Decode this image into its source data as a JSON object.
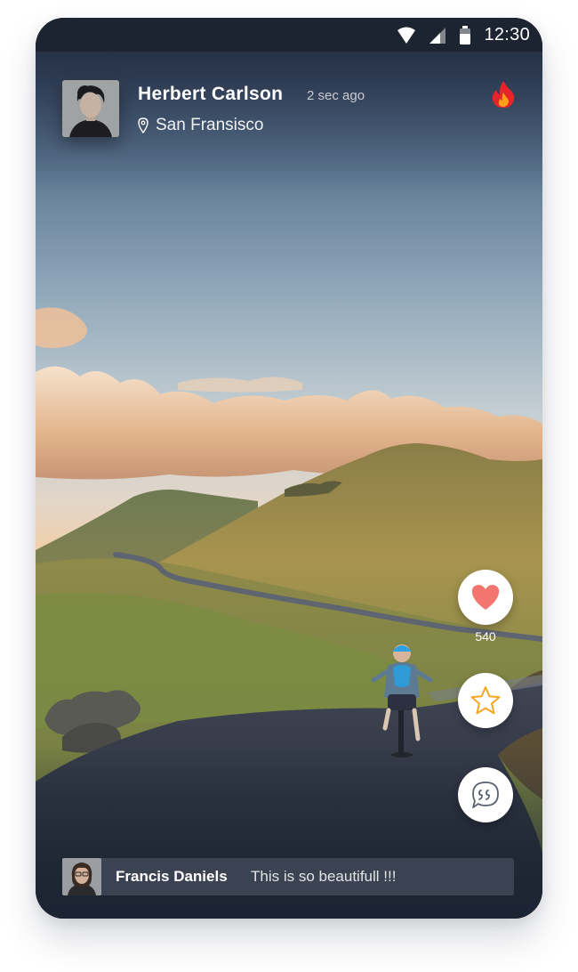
{
  "status_bar": {
    "time": "12:30",
    "icons": [
      "wifi-icon",
      "cell-signal-icon",
      "battery-icon"
    ]
  },
  "post": {
    "author": "Herbert Carlson",
    "time_ago": "2 sec ago",
    "location": "San Fransisco",
    "trending_icon": "fire-icon",
    "like_count": "540"
  },
  "actions": [
    {
      "name": "like",
      "icon": "heart-icon"
    },
    {
      "name": "favorite",
      "icon": "star-icon"
    },
    {
      "name": "comment",
      "icon": "quote-bubble-icon"
    }
  ],
  "comment": {
    "author": "Francis Daniels",
    "text": "This is so beautifull !!!"
  },
  "colors": {
    "heart": "#f2766f",
    "star": "#f5a623",
    "fire_outer": "#e8232a",
    "fire_inner": "#ff9f1a",
    "status_bar": "#1d2431"
  }
}
